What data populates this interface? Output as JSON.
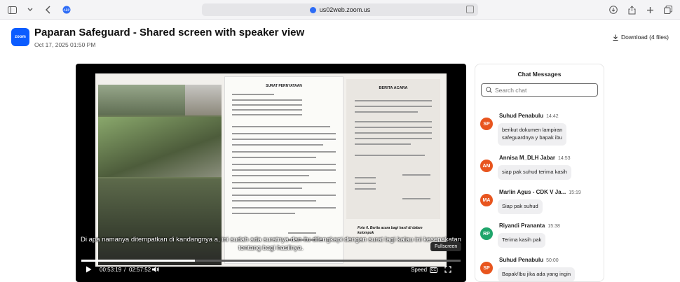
{
  "browser": {
    "url": "us02web.zoom.us",
    "left_icons": [
      "sidebar-icon",
      "chevron-down-icon",
      "back-arrow-icon",
      "extension-icon"
    ],
    "right_icons": [
      "download-icon",
      "share-icon",
      "new-tab-plus-icon",
      "tabs-overview-icon"
    ]
  },
  "header": {
    "logo_text": "zoom",
    "title": "Paparan Safeguard - Shared screen with speaker view",
    "date": "Oct 17, 2025 01:50 PM",
    "download_label": "Download (4 files)"
  },
  "player": {
    "slide": {
      "letter_title": "SURAT PERNYATAAN",
      "ba_title": "BERITA ACARA",
      "ba_caption": "Foto 6. Berita acara bagi hasil di dalam kelompok"
    },
    "subtitle_line1": "Di apa namanya ditempatkan di kandangnya a, ini sudah ada suratnya dan itu dilengkapi dengan surat lagi kalau ini kesepakatan",
    "subtitle_line2": "tentang bagi hasilnya.",
    "tooltip": "Fullscreen",
    "current_time": "00:53:19",
    "separator": "/",
    "total_time": "02:57:52",
    "progress": 0.2996,
    "speed_label": "Speed",
    "cc_label": "CC"
  },
  "chat": {
    "title": "Chat Messages",
    "search_placeholder": "Search chat",
    "messages": [
      {
        "initials": "SP",
        "color": "#e8551e",
        "sender": "Suhud Penabulu",
        "time": "14:42",
        "text": [
          "berikut dokumen lampiran",
          "safeguardnya y bapak ibu"
        ]
      },
      {
        "initials": "AM",
        "color": "#e8551e",
        "sender": "Annisa M_DLH Jabar",
        "time": "14:53",
        "text": [
          "siap pak suhud terima kasih"
        ]
      },
      {
        "initials": "MA",
        "color": "#e8551e",
        "sender": "Marlin Agus - CDK V Ja...",
        "time": "15:19",
        "text": [
          "Siap pak suhud"
        ]
      },
      {
        "initials": "RP",
        "color": "#1fa56b",
        "sender": "Riyandi Prananta",
        "time": "15:38",
        "text": [
          "Terima kasih pak"
        ]
      },
      {
        "initials": "SP",
        "color": "#e8551e",
        "sender": "Suhud Penabulu",
        "time": "50:00",
        "text": [
          "Bapak/Ibu jika ada yang ingin"
        ]
      }
    ]
  }
}
